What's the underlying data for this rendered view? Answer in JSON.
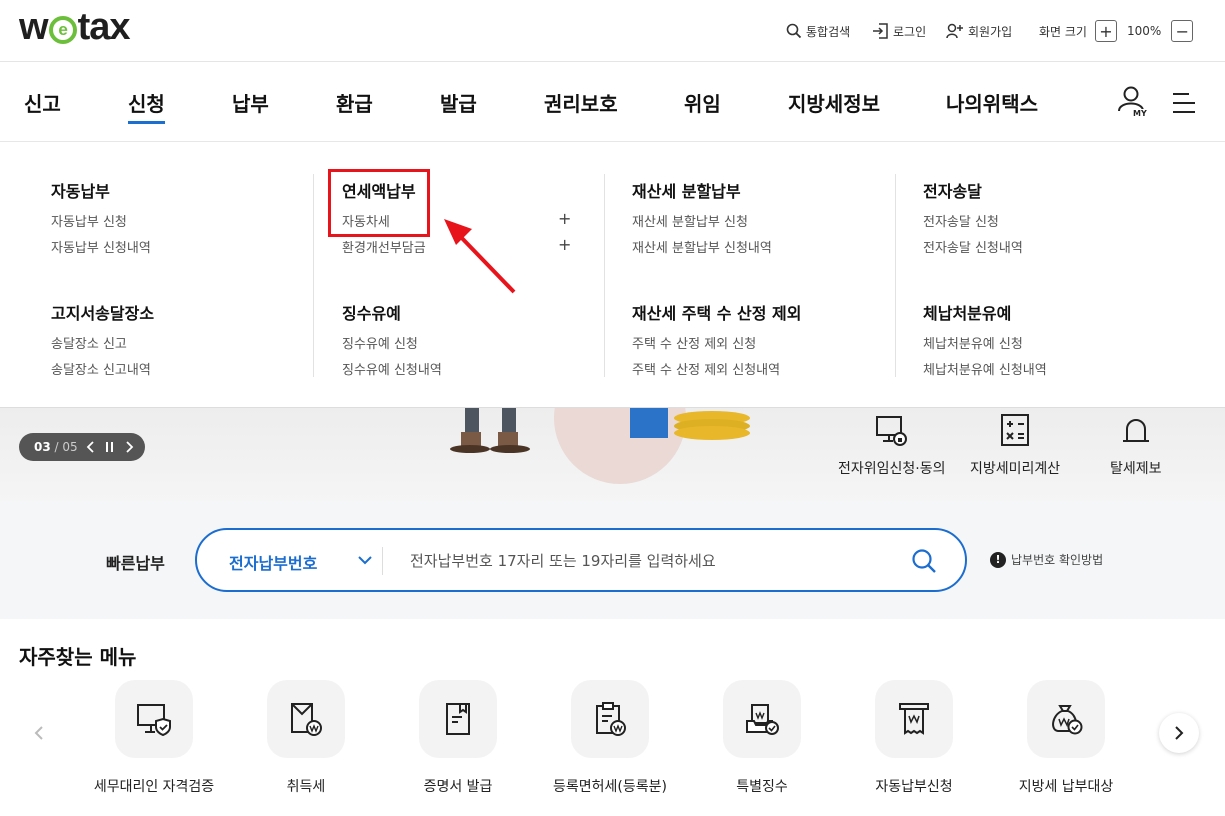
{
  "header": {
    "logo": {
      "pre": "w",
      "mid": "e",
      "post": "tax"
    },
    "search_label": "통합검색",
    "login_label": "로그인",
    "signup_label": "회원가입",
    "font_size_label": "화면 크기",
    "zoom_level": "100%",
    "zoom_in": "+",
    "zoom_out": "−"
  },
  "nav": {
    "items": [
      "신고",
      "신청",
      "납부",
      "환급",
      "발급",
      "권리보호",
      "위임",
      "지방세정보",
      "나의위택스"
    ],
    "active": "신청",
    "my_label": "MY"
  },
  "mega_menu": {
    "groups": [
      {
        "title": "자동납부",
        "links": [
          "자동납부 신청",
          "자동납부 신청내역"
        ]
      },
      {
        "title": "연세액납부",
        "links": [
          "자동차세",
          "환경개선부담금"
        ],
        "expand": "+"
      },
      {
        "title": "재산세 분할납부",
        "links": [
          "재산세 분할납부 신청",
          "재산세 분할납부 신청내역"
        ]
      },
      {
        "title": "전자송달",
        "links": [
          "전자송달 신청",
          "전자송달 신청내역"
        ]
      },
      {
        "title": "고지서송달장소",
        "links": [
          "송달장소 신고",
          "송달장소 신고내역"
        ]
      },
      {
        "title": "징수유예",
        "links": [
          "징수유예 신청",
          "징수유예 신청내역"
        ]
      },
      {
        "title": "재산세 주택 수 산정 제외",
        "links": [
          "주택 수 산정 제외 신청",
          "주택 수 산정 제외 신청내역"
        ]
      },
      {
        "title": "체납처분유예",
        "links": [
          "체납처분유예 신청",
          "체납처분유예 신청내역"
        ]
      }
    ]
  },
  "banner": {
    "pager_current": "03",
    "pager_total": "/ 05",
    "quick_links": [
      "전자위임신청·동의",
      "지방세미리계산",
      "탈세제보"
    ]
  },
  "fast_pay": {
    "label": "빠른납부",
    "select_value": "전자납부번호",
    "placeholder": "전자납부번호 17자리 또는 19자리를 입력하세요",
    "help_label": "납부번호 확인방법"
  },
  "frequent_menu": {
    "title": "자주찾는 메뉴",
    "items": [
      "세무대리인 자격검증",
      "취득세",
      "증명서 발급",
      "등록면허세(등록분)",
      "특별징수",
      "자동납부신청",
      "지방세 납부대상"
    ]
  },
  "colors": {
    "accent": "#1b6dd0",
    "highlight": "#e8141b",
    "logo_green": "#6cbf3b"
  }
}
